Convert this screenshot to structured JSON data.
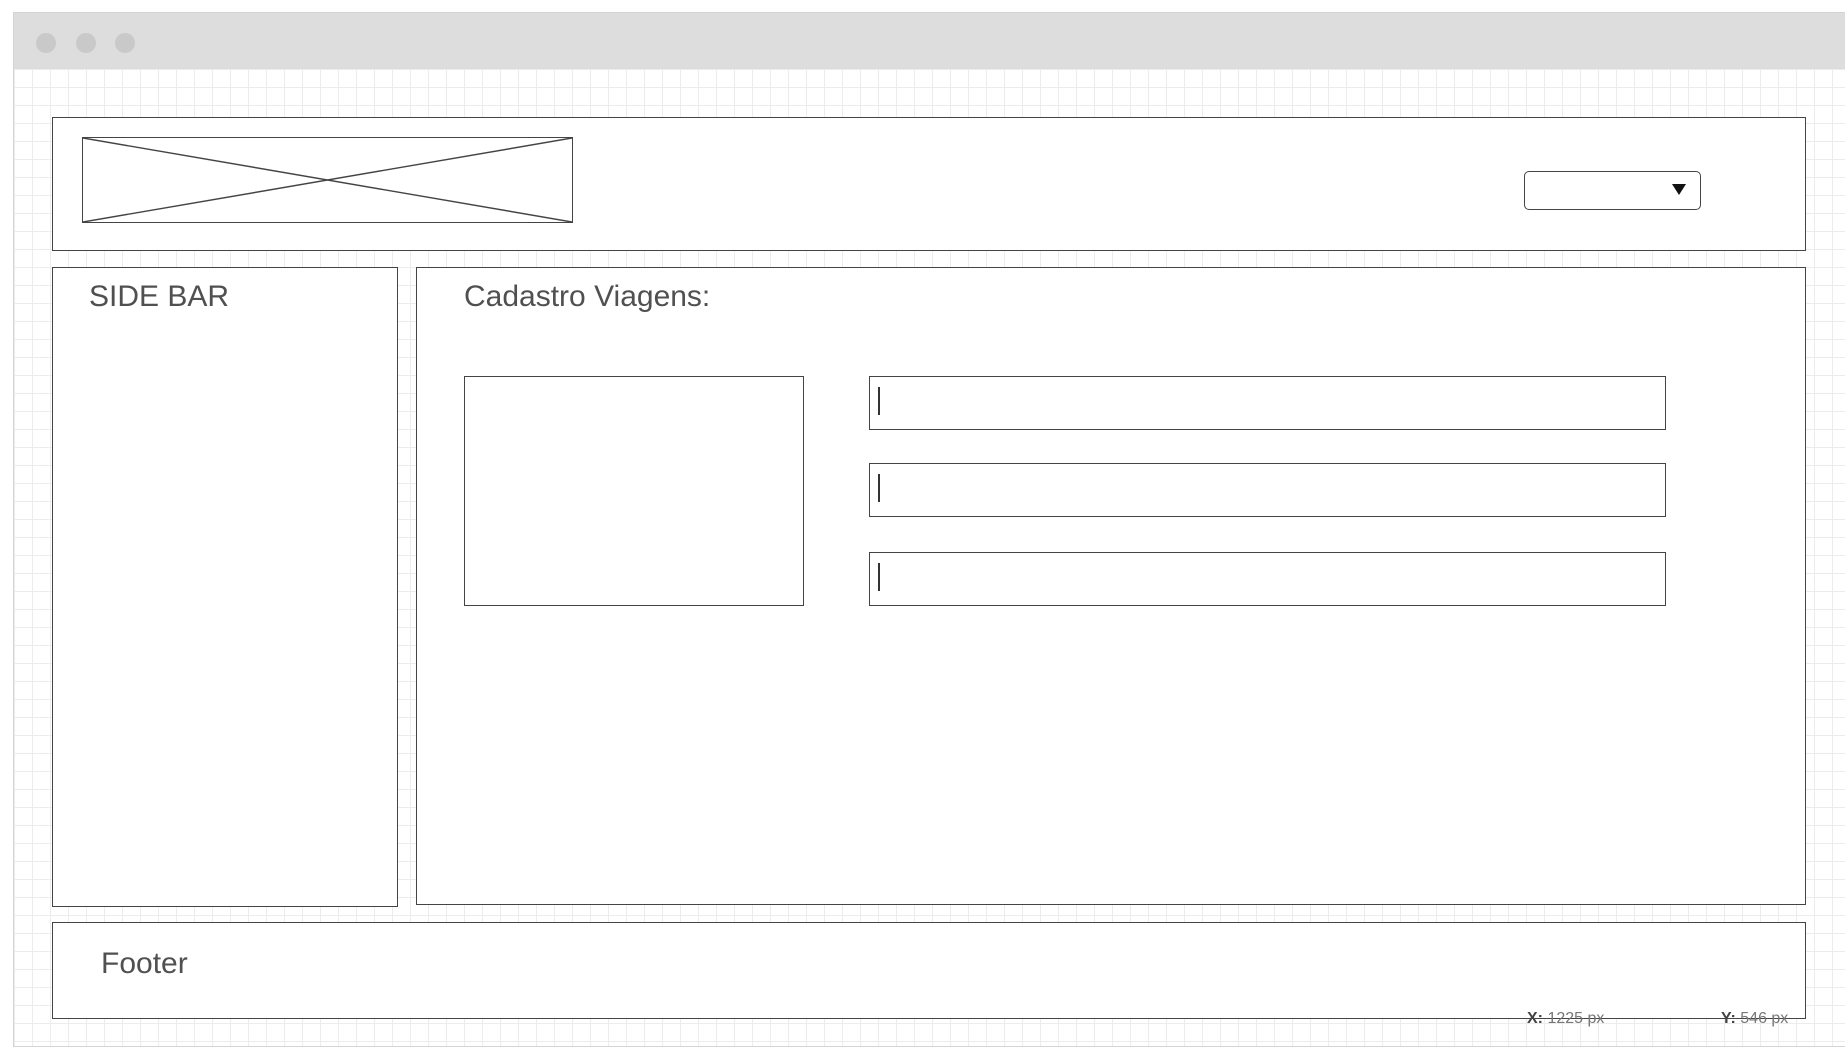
{
  "header": {
    "logo_icon": "image-placeholder-icon",
    "dropdown_value": "",
    "dropdown_icon": "caret-down-icon"
  },
  "sidebar": {
    "title": "SIDE BAR"
  },
  "main": {
    "title": "Cadastro Viagens:",
    "image_icon": "image-placeholder",
    "fields": [
      {
        "value": ""
      },
      {
        "value": ""
      },
      {
        "value": ""
      }
    ]
  },
  "footer": {
    "title": "Footer"
  },
  "status": {
    "x_label": "X:",
    "x_value": "1225 px",
    "y_label": "Y:",
    "y_value": "546 px"
  },
  "colors": {
    "titlebar": "#dddddd",
    "window_dots": "#c9c9c9",
    "border": "#444444",
    "grid": "#ececec",
    "text": "#505050"
  }
}
